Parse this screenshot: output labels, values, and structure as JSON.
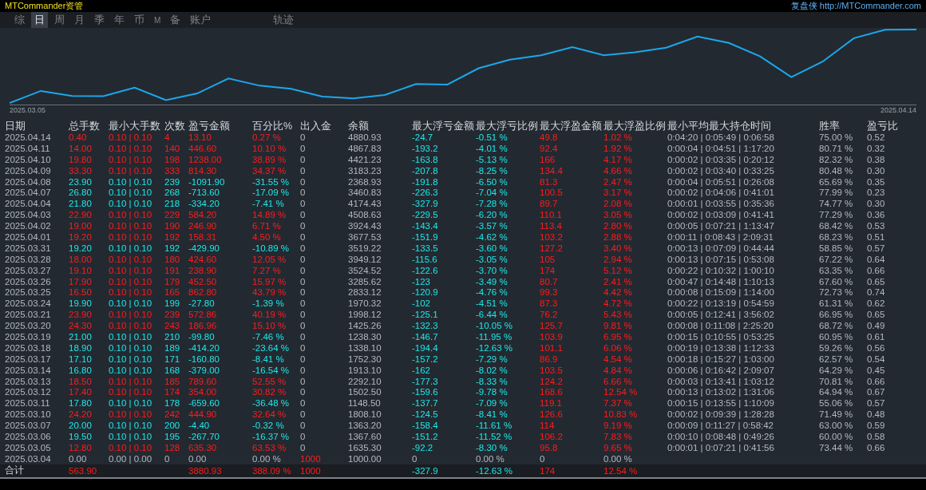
{
  "header": {
    "brand": "MTCommander资管",
    "link": "复盘侠 http://MTCommander.com"
  },
  "tabs": [
    {
      "label": "综",
      "selected": false
    },
    {
      "label": "日",
      "selected": true
    },
    {
      "label": "周",
      "selected": false
    },
    {
      "label": "月",
      "selected": false
    },
    {
      "label": "季",
      "selected": false
    },
    {
      "label": "年",
      "selected": false
    },
    {
      "label": "币",
      "selected": false
    },
    {
      "label": "M",
      "selected": false
    },
    {
      "label": "备",
      "selected": false
    },
    {
      "label": "账户",
      "selected": false
    }
  ],
  "track_tab": {
    "label": "轨迹",
    "selected": false
  },
  "chart": {
    "start_label": "2025.03.05",
    "end_label": "2025.04.14"
  },
  "table": {
    "columns": [
      "日期",
      "总手数",
      "最小大手数",
      "次数",
      "盈亏金额",
      "百分比%",
      "出入金",
      "余额",
      "最大浮亏金额",
      "最大浮亏比例",
      "最大浮盈金额",
      "最大浮盈比例",
      "最小平均最大持仓时间",
      "胜率",
      "盈亏比"
    ],
    "rows": [
      {
        "color": "#ff1c1c",
        "float_colored": true,
        "deposit": false,
        "cells": [
          "2025.04.14",
          "0.40",
          "0.10 | 0.10",
          "4",
          "13.10",
          "0.27 %",
          "0",
          "4880.93",
          "-24.7",
          "-0.51 %",
          "49.8",
          "1.02 %",
          "0:04:20 | 0:05:49 | 0:06:58",
          "75.00 %",
          "0.52"
        ]
      },
      {
        "color": "#ff1c1c",
        "float_colored": true,
        "deposit": false,
        "cells": [
          "2025.04.11",
          "14.00",
          "0.10 | 0.10",
          "140",
          "446.60",
          "10.10 %",
          "0",
          "4867.83",
          "-193.2",
          "-4.01 %",
          "92.4",
          "1.92 %",
          "0:00:04 | 0:04:51 | 1:17:20",
          "80.71 %",
          "0.32"
        ]
      },
      {
        "color": "#ff1c1c",
        "float_colored": true,
        "deposit": false,
        "cells": [
          "2025.04.10",
          "19.80",
          "0.10 | 0.10",
          "198",
          "1238.00",
          "38.89 %",
          "0",
          "4421.23",
          "-163.8",
          "-5.13 %",
          "166",
          "4.17 %",
          "0:00:02 | 0:03:35 | 0:20:12",
          "82.32 %",
          "0.38"
        ]
      },
      {
        "color": "#ff1c1c",
        "float_colored": true,
        "deposit": false,
        "cells": [
          "2025.04.09",
          "33.30",
          "0.10 | 0.10",
          "333",
          "814.30",
          "34.37 %",
          "0",
          "3183.23",
          "-207.8",
          "-8.25 %",
          "134.4",
          "4.66 %",
          "0:00:02 | 0:03:40 | 0:33:25",
          "80.48 %",
          "0.30"
        ]
      },
      {
        "color": "#1ee8e8",
        "float_colored": true,
        "deposit": false,
        "cells": [
          "2025.04.08",
          "23.90",
          "0.10 | 0.10",
          "239",
          "-1091.90",
          "-31.55 %",
          "0",
          "2368.93",
          "-191.8",
          "-6.50 %",
          "81.3",
          "2.47 %",
          "0:00:04 | 0:05:51 | 0:26:08",
          "65.69 %",
          "0.35"
        ]
      },
      {
        "color": "#1ee8e8",
        "float_colored": true,
        "deposit": false,
        "cells": [
          "2025.04.07",
          "26.80",
          "0.10 | 0.10",
          "268",
          "-713.60",
          "-17.09 %",
          "0",
          "3460.83",
          "-226.3",
          "-7.04 %",
          "100.5",
          "3.17 %",
          "0:00:02 | 0:04:06 | 0:41:01",
          "77.99 %",
          "0.23"
        ]
      },
      {
        "color": "#1ee8e8",
        "float_colored": true,
        "deposit": false,
        "cells": [
          "2025.04.04",
          "21.80",
          "0.10 | 0.10",
          "218",
          "-334.20",
          "-7.41 %",
          "0",
          "4174.43",
          "-327.9",
          "-7.28 %",
          "89.7",
          "2.08 %",
          "0:00:01 | 0:03:55 | 0:35:36",
          "74.77 %",
          "0.30"
        ]
      },
      {
        "color": "#ff1c1c",
        "float_colored": true,
        "deposit": false,
        "cells": [
          "2025.04.03",
          "22.90",
          "0.10 | 0.10",
          "229",
          "584.20",
          "14.89 %",
          "0",
          "4508.63",
          "-229.5",
          "-6.20 %",
          "110.1",
          "3.05 %",
          "0:00:02 | 0:03:09 | 0:41:41",
          "77.29 %",
          "0.36"
        ]
      },
      {
        "color": "#ff1c1c",
        "float_colored": true,
        "deposit": false,
        "cells": [
          "2025.04.02",
          "19.00",
          "0.10 | 0.10",
          "190",
          "246.90",
          "6.71 %",
          "0",
          "3924.43",
          "-143.4",
          "-3.57 %",
          "113.4",
          "2.80 %",
          "0:00:05 | 0:07:21 | 1:13:47",
          "68.42 %",
          "0.53"
        ]
      },
      {
        "color": "#ff1c1c",
        "float_colored": true,
        "deposit": false,
        "cells": [
          "2025.04.01",
          "19.20",
          "0.10 | 0.10",
          "192",
          "158.31",
          "4.50 %",
          "0",
          "3677.53",
          "-151.9",
          "-4.62 %",
          "103.2",
          "2.88 %",
          "0:00:11 | 0:08:43 | 2:09:31",
          "68.23 %",
          "0.51"
        ]
      },
      {
        "color": "#1ee8e8",
        "float_colored": true,
        "deposit": false,
        "cells": [
          "2025.03.31",
          "19.20",
          "0.10 | 0.10",
          "192",
          "-429.90",
          "-10.89 %",
          "0",
          "3519.22",
          "-133.5",
          "-3.60 %",
          "127.2",
          "3.40 %",
          "0:00:13 | 0:07:09 | 0:44:44",
          "58.85 %",
          "0.57"
        ]
      },
      {
        "color": "#ff1c1c",
        "float_colored": true,
        "deposit": false,
        "cells": [
          "2025.03.28",
          "18.00",
          "0.10 | 0.10",
          "180",
          "424.60",
          "12.05 %",
          "0",
          "3949.12",
          "-115.6",
          "-3.05 %",
          "105",
          "2.94 %",
          "0:00:13 | 0:07:15 | 0:53:08",
          "67.22 %",
          "0.64"
        ]
      },
      {
        "color": "#ff1c1c",
        "float_colored": true,
        "deposit": false,
        "cells": [
          "2025.03.27",
          "19.10",
          "0.10 | 0.10",
          "191",
          "238.90",
          "7.27 %",
          "0",
          "3524.52",
          "-122.6",
          "-3.70 %",
          "174",
          "5.12 %",
          "0:00:22 | 0:10:32 | 1:00:10",
          "63.35 %",
          "0.66"
        ]
      },
      {
        "color": "#ff1c1c",
        "float_colored": true,
        "deposit": false,
        "cells": [
          "2025.03.26",
          "17.90",
          "0.10 | 0.10",
          "179",
          "452.50",
          "15.97 %",
          "0",
          "3285.62",
          "-123",
          "-3.49 %",
          "80.7",
          "2.41 %",
          "0:00:47 | 0:14:48 | 1:10:13",
          "67.60 %",
          "0.65"
        ]
      },
      {
        "color": "#ff1c1c",
        "float_colored": true,
        "deposit": false,
        "cells": [
          "2025.03.25",
          "16.50",
          "0.10 | 0.10",
          "165",
          "862.80",
          "43.79 %",
          "0",
          "2833.12",
          "-120.9",
          "-4.76 %",
          "99.3",
          "4.42 %",
          "0:00:08 | 0:15:09 | 1:14:00",
          "72.73 %",
          "0.74"
        ]
      },
      {
        "color": "#1ee8e8",
        "float_colored": true,
        "deposit": false,
        "cells": [
          "2025.03.24",
          "19.90",
          "0.10 | 0.10",
          "199",
          "-27.80",
          "-1.39 %",
          "0",
          "1970.32",
          "-102",
          "-4.51 %",
          "87.3",
          "4.72 %",
          "0:00:22 | 0:13:19 | 0:54:59",
          "61.31 %",
          "0.62"
        ]
      },
      {
        "color": "#ff1c1c",
        "float_colored": true,
        "deposit": false,
        "cells": [
          "2025.03.21",
          "23.90",
          "0.10 | 0.10",
          "239",
          "572.86",
          "40.19 %",
          "0",
          "1998.12",
          "-125.1",
          "-6.44 %",
          "76.2",
          "5.43 %",
          "0:00:05 | 0:12:41 | 3:56:02",
          "66.95 %",
          "0.65"
        ]
      },
      {
        "color": "#ff1c1c",
        "float_colored": true,
        "deposit": false,
        "cells": [
          "2025.03.20",
          "24.30",
          "0.10 | 0.10",
          "243",
          "186.96",
          "15.10 %",
          "0",
          "1425.26",
          "-132.3",
          "-10.05 %",
          "125.7",
          "9.81 %",
          "0:00:08 | 0:11:08 | 2:25:20",
          "68.72 %",
          "0.49"
        ]
      },
      {
        "color": "#1ee8e8",
        "float_colored": true,
        "deposit": false,
        "cells": [
          "2025.03.19",
          "21.00",
          "0.10 | 0.10",
          "210",
          "-99.80",
          "-7.46 %",
          "0",
          "1238.30",
          "-146.7",
          "-11.95 %",
          "103.9",
          "6.95 %",
          "0:00:15 | 0:10:55 | 0:53:25",
          "60.95 %",
          "0.61"
        ]
      },
      {
        "color": "#1ee8e8",
        "float_colored": true,
        "deposit": false,
        "cells": [
          "2025.03.18",
          "18.90",
          "0.10 | 0.10",
          "189",
          "-414.20",
          "-23.64 %",
          "0",
          "1338.10",
          "-194.4",
          "-12.63 %",
          "101.1",
          "6.06 %",
          "0:00:19 | 0:13:38 | 1:12:33",
          "59.26 %",
          "0.56"
        ]
      },
      {
        "color": "#1ee8e8",
        "float_colored": true,
        "deposit": false,
        "cells": [
          "2025.03.17",
          "17.10",
          "0.10 | 0.10",
          "171",
          "-160.80",
          "-8.41 %",
          "0",
          "1752.30",
          "-157.2",
          "-7.29 %",
          "86.9",
          "4.54 %",
          "0:00:18 | 0:15:27 | 1:03:00",
          "62.57 %",
          "0.54"
        ]
      },
      {
        "color": "#1ee8e8",
        "float_colored": true,
        "deposit": false,
        "cells": [
          "2025.03.14",
          "16.80",
          "0.10 | 0.10",
          "168",
          "-379.00",
          "-16.54 %",
          "0",
          "1913.10",
          "-162",
          "-8.02 %",
          "103.5",
          "4.84 %",
          "0:00:06 | 0:16:42 | 2:09:07",
          "64.29 %",
          "0.45"
        ]
      },
      {
        "color": "#ff1c1c",
        "float_colored": true,
        "deposit": false,
        "cells": [
          "2025.03.13",
          "18.50",
          "0.10 | 0.10",
          "185",
          "789.60",
          "52.55 %",
          "0",
          "2292.10",
          "-177.3",
          "-8.33 %",
          "124.2",
          "6.66 %",
          "0:00:03 | 0:13:41 | 1:03:12",
          "70.81 %",
          "0.66"
        ]
      },
      {
        "color": "#ff1c1c",
        "float_colored": true,
        "deposit": false,
        "cells": [
          "2025.03.12",
          "17.40",
          "0.10 | 0.10",
          "174",
          "354.00",
          "30.82 %",
          "0",
          "1502.50",
          "-159.6",
          "-9.78 %",
          "168.6",
          "12.54 %",
          "0:00:13 | 0:13:02 | 1:31:06",
          "64.94 %",
          "0.67"
        ]
      },
      {
        "color": "#1ee8e8",
        "float_colored": true,
        "deposit": false,
        "cells": [
          "2025.03.11",
          "17.80",
          "0.10 | 0.10",
          "178",
          "-659.60",
          "-36.48 %",
          "0",
          "1148.50",
          "-137.7",
          "-7.09 %",
          "119.1",
          "7.37 %",
          "0:00:15 | 0:13:55 | 1:10:09",
          "55.06 %",
          "0.57"
        ]
      },
      {
        "color": "#ff1c1c",
        "float_colored": true,
        "deposit": false,
        "cells": [
          "2025.03.10",
          "24.20",
          "0.10 | 0.10",
          "242",
          "444.90",
          "32.64 %",
          "0",
          "1808.10",
          "-124.5",
          "-8.41 %",
          "126.6",
          "10.83 %",
          "0:00:02 | 0:09:39 | 1:28:28",
          "71.49 %",
          "0.48"
        ]
      },
      {
        "color": "#1ee8e8",
        "float_colored": true,
        "deposit": false,
        "cells": [
          "2025.03.07",
          "20.00",
          "0.10 | 0.10",
          "200",
          "-4.40",
          "-0.32 %",
          "0",
          "1363.20",
          "-158.4",
          "-11.61 %",
          "114",
          "9.19 %",
          "0:00:09 | 0:11:27 | 0:58:42",
          "63.00 %",
          "0.59"
        ]
      },
      {
        "color": "#1ee8e8",
        "float_colored": true,
        "deposit": false,
        "cells": [
          "2025.03.06",
          "19.50",
          "0.10 | 0.10",
          "195",
          "-267.70",
          "-16.37 %",
          "0",
          "1367.60",
          "-151.2",
          "-11.52 %",
          "106.2",
          "7.83 %",
          "0:00:10 | 0:08:48 | 0:49:26",
          "60.00 %",
          "0.58"
        ]
      },
      {
        "color": "#ff1c1c",
        "float_colored": true,
        "deposit": false,
        "cells": [
          "2025.03.05",
          "12.80",
          "0.10 | 0.10",
          "128",
          "635.30",
          "63.53 %",
          "0",
          "1635.30",
          "-92.2",
          "-8.30 %",
          "95.8",
          "9.65 %",
          "0:00:01 | 0:07:21 | 0:41:56",
          "73.44 %",
          "0.66"
        ]
      },
      {
        "color": "#b4b9c0",
        "float_colored": false,
        "deposit": true,
        "cells": [
          "2025.03.04",
          "0.00",
          "0.00 | 0.00",
          "0",
          "0.00",
          "0.00 %",
          "1000",
          "1000.00",
          "0",
          "0.00 %",
          "0",
          "0.00 %"
        ]
      }
    ],
    "total": {
      "label": "合计",
      "lots": "563.90",
      "profit": "3880.93",
      "percent": "388.09 %",
      "deposit": "1000",
      "max_float_loss": "-327.9",
      "max_float_loss_pct": "-12.63 %",
      "max_float_profit": "174",
      "max_float_profit_pct": "12.54 %"
    }
  }
}
